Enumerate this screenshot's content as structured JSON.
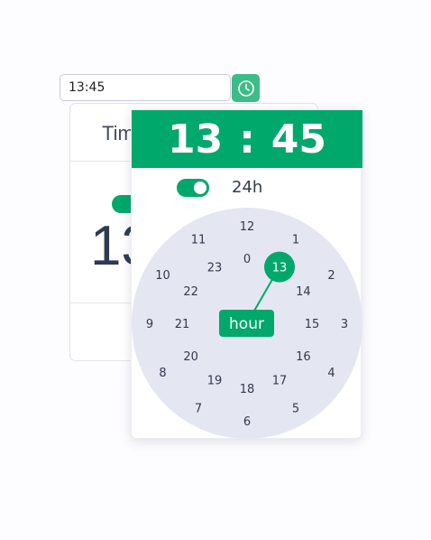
{
  "input": {
    "value": "13:45"
  },
  "background_card": {
    "title": "Tim",
    "big_time": "13"
  },
  "picker": {
    "hours": "13",
    "separator": ":",
    "minutes": "45",
    "mode_label": "24h",
    "selected_hour": "13",
    "unit_label": "hour",
    "outer_ring": [
      "12",
      "1",
      "2",
      "3",
      "4",
      "5",
      "6",
      "7",
      "8",
      "9",
      "10",
      "11"
    ],
    "inner_ring": [
      "0",
      "13",
      "14",
      "15",
      "16",
      "17",
      "18",
      "19",
      "20",
      "21",
      "22",
      "23"
    ]
  },
  "colors": {
    "accent": "#00a86b",
    "dial_bg": "#e4e7f2",
    "button": "#3cbc86"
  }
}
